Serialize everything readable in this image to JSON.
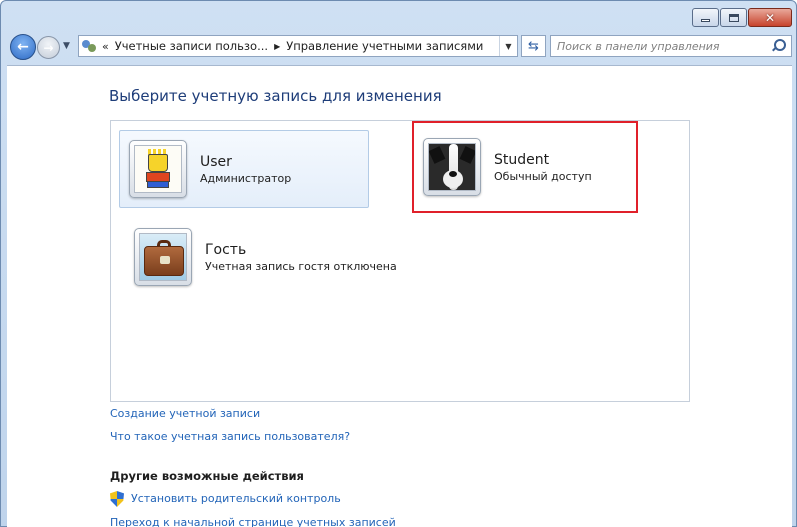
{
  "window": {
    "minimize_icon": "minimize-icon",
    "maximize_icon": "maximize-icon",
    "close_icon": "close-icon"
  },
  "navigation": {
    "back_icon": "back-arrow-icon",
    "forward_icon": "forward-arrow-icon",
    "address": {
      "overflow_marker": "«",
      "crumb1": "Учетные записи пользо...",
      "crumb2": "Управление учетными записями"
    },
    "search_placeholder": "Поиск в панели управления"
  },
  "main": {
    "heading": "Выберите учетную запись для изменения",
    "accounts": [
      {
        "name": "User",
        "role": "Администратор",
        "avatar": "bart-simpson-avatar"
      },
      {
        "name": "Student",
        "role": "Обычный доступ",
        "avatar": "dog-avatar",
        "highlight_color": "#e0202a"
      },
      {
        "name": "Гость",
        "role": "Учетная запись гостя отключена",
        "avatar": "suitcase-avatar"
      }
    ],
    "links": {
      "create_account": "Создание учетной записи",
      "what_is_account": "Что такое учетная запись пользователя?"
    },
    "other_actions": {
      "heading": "Другие возможные действия",
      "parental_control": "Установить родительский контроль",
      "goto_main": "Переход к начальной странице учетных записей"
    }
  },
  "colors": {
    "heading": "#1e3d79",
    "link": "#2264b8",
    "selection_border": "#b3cbe6"
  }
}
